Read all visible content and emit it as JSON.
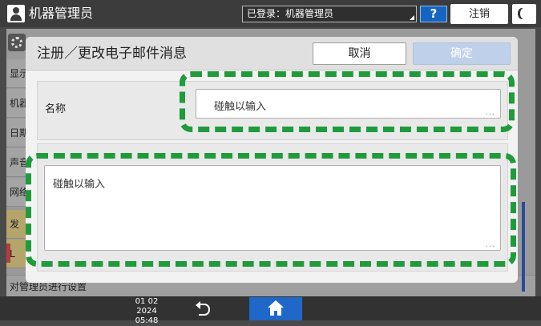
{
  "topbar": {
    "app_title": "机器管理员",
    "login_status": "已登录：机器管理员",
    "help_label": "?",
    "logout_label": "注销"
  },
  "background": {
    "sidebar_items": [
      "显示",
      "机器",
      "日期",
      "声音",
      "网络",
      "发",
      "L"
    ],
    "footer_text": "对管理员进行设置"
  },
  "dialog": {
    "title": "注册／更改电子邮件消息",
    "cancel_label": "取消",
    "ok_label": "确定",
    "name_label": "名称",
    "name_placeholder": "碰触以输入",
    "body_placeholder": "碰触以输入"
  },
  "statusbar": {
    "date": "01 02 2024",
    "time": "05:48"
  },
  "colors": {
    "highlight_dash": "#1f9b3b",
    "home_button": "#1f67c9",
    "help_button": "#1565c0"
  },
  "icons": [
    "user-icon",
    "gear-icon",
    "moon-icon",
    "back-icon",
    "home-icon"
  ]
}
